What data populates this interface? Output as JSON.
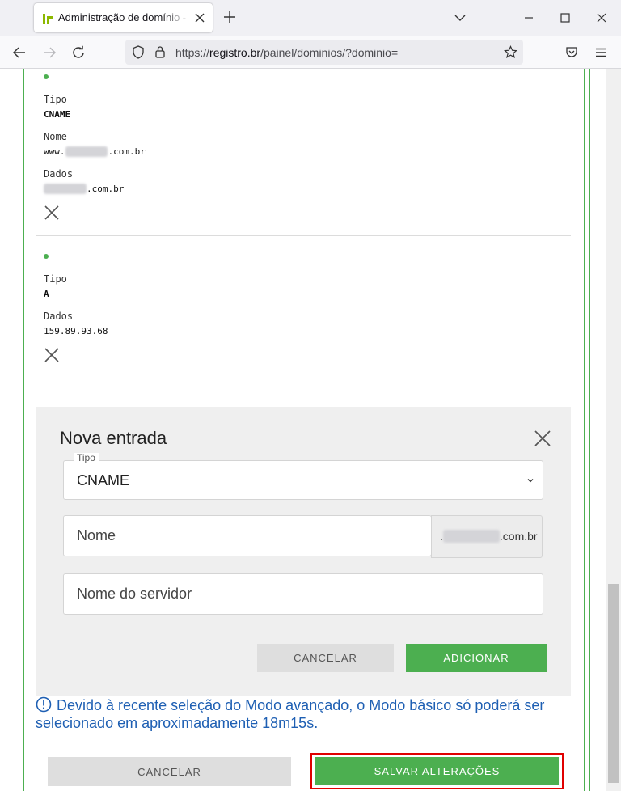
{
  "browser": {
    "tab_title": "Administração de domínio - Registro.br",
    "url_prefix": "https://",
    "url_domain": "registro.br",
    "url_path": "/painel/dominios/?dominio="
  },
  "records": [
    {
      "tipo_label": "Tipo",
      "tipo": "CNAME",
      "nome_label": "Nome",
      "nome_prefix": "www.",
      "nome_hidden": "xxxxxxxx",
      "nome_suffix": ".com.br",
      "dados_label": "Dados",
      "dados_hidden": "xxxxxxxx",
      "dados_suffix": ".com.br"
    },
    {
      "tipo_label": "Tipo",
      "tipo": "A",
      "dados_label": "Dados",
      "dados": "159.89.93.68"
    }
  ],
  "nova_entrada": {
    "title": "Nova entrada",
    "tipo_legend": "Tipo",
    "tipo_value": "CNAME",
    "nome_placeholder": "Nome",
    "suffix_dot": ".",
    "suffix_hidden": "xxxxxxxxxx",
    "suffix_domain": ".com.br",
    "servidor_placeholder": "Nome do servidor",
    "cancel_label": "CANCELAR",
    "add_label": "ADICIONAR"
  },
  "notice": {
    "text": "Devido à recente seleção do Modo avançado, o Modo básico só poderá ser selecionado em aproximadamente 18m15s."
  },
  "footer": {
    "cancel_label": "CANCELAR",
    "save_label": "SALVAR ALTERAÇÕES"
  },
  "colors": {
    "accent_green": "#4caf50",
    "notice_blue": "#1e5fb3",
    "highlight_red": "#e00000"
  }
}
